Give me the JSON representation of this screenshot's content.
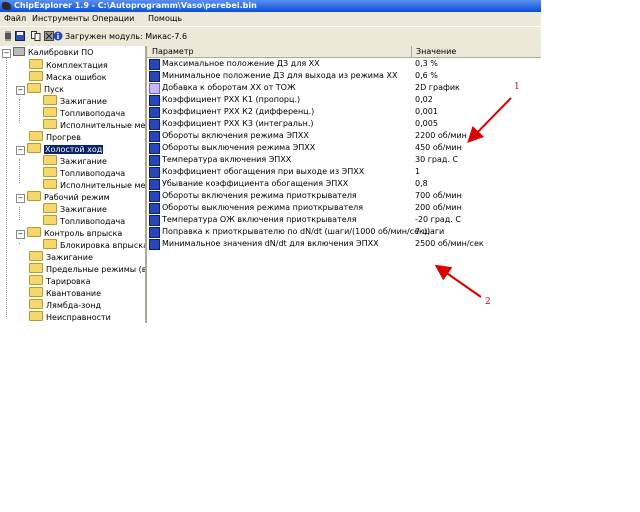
{
  "window": {
    "title": "ChipExplorer 1.9 - C:\\Autoprogramm\\Vaso\\perebei.bin"
  },
  "menu": [
    "Файл",
    "Инструменты",
    "Операции",
    "Помощь"
  ],
  "toolbar": {
    "status": "Загружен модуль: Микас-7.6",
    "icons": [
      "chip-icon",
      "save-icon",
      "copy-icon",
      "compare-icon",
      "info-icon"
    ]
  },
  "tree": {
    "root": "Калибровки ПО",
    "items": [
      {
        "label": "Комплектация"
      },
      {
        "label": "Маска ошибок"
      },
      {
        "label": "Пуск"
      },
      {
        "label": "Зажигание"
      },
      {
        "label": "Топливоподача"
      },
      {
        "label": "Исполнительные меха"
      },
      {
        "label": "Прогрев"
      },
      {
        "label": "Холостой ход"
      },
      {
        "label": "Зажигание"
      },
      {
        "label": "Топливоподача"
      },
      {
        "label": "Исполнительные меха"
      },
      {
        "label": "Рабочий режим"
      },
      {
        "label": "Зажигание"
      },
      {
        "label": "Топливоподача"
      },
      {
        "label": "Контроль впрыска"
      },
      {
        "label": "Блокировка впрыска"
      },
      {
        "label": "Зажигание"
      },
      {
        "label": "Предельные режимы (вкл"
      },
      {
        "label": "Тарировка"
      },
      {
        "label": "Квантование"
      },
      {
        "label": "Лямбда-зонд"
      },
      {
        "label": "Неисправности"
      }
    ]
  },
  "table": {
    "col_param": "Параметр",
    "col_value": "Значение",
    "rows": [
      {
        "name": "Максимальное положение ДЗ для ХХ",
        "value": "0,3 %"
      },
      {
        "name": "Минимальное положение ДЗ для выхода из режима ХХ",
        "value": "0,6 %"
      },
      {
        "name": "Добавка к оборотам ХХ от ТОЖ",
        "value": "2D график"
      },
      {
        "name": "Коэффициент РХХ К1 (пропорц.)",
        "value": "0,02"
      },
      {
        "name": "Коэффициент РХХ К2 (дифференц.)",
        "value": "0,001"
      },
      {
        "name": "Коэффициент РХХ К3 (интегральн.)",
        "value": "0,005"
      },
      {
        "name": "Обороты включения режима ЭПХХ",
        "value": "2200 об/мин"
      },
      {
        "name": "Обороты выключения режима ЭПХХ",
        "value": "450 об/мин"
      },
      {
        "name": "Температура включения ЭПХХ",
        "value": "30 град. С"
      },
      {
        "name": "Коэффициент обогащения при выходе из ЭПХХ",
        "value": "1"
      },
      {
        "name": "Убывание коэффициента обогащения ЭПХХ",
        "value": "0,8"
      },
      {
        "name": "Обороты включения режима приоткрывателя",
        "value": "700 об/мин"
      },
      {
        "name": "Обороты выключения режима приоткрывателя",
        "value": "200 об/мин"
      },
      {
        "name": "Температура ОЖ включения приоткрывателя",
        "value": "-20 град. С"
      },
      {
        "name": "Поправка к приоткрывателю по dN/dt (шаги/(1000 об/мин/сек))",
        "value": "7 шаги"
      },
      {
        "name": "Минимальное значения dN/dt для включения ЭПХХ",
        "value": "2500 об/мин/сек"
      }
    ]
  },
  "annotations": {
    "a1": "1",
    "a2": "2"
  },
  "colors": {
    "selection": "#0a246a",
    "arrow": "#dd0000",
    "titlebar": "#0a4fd8"
  }
}
